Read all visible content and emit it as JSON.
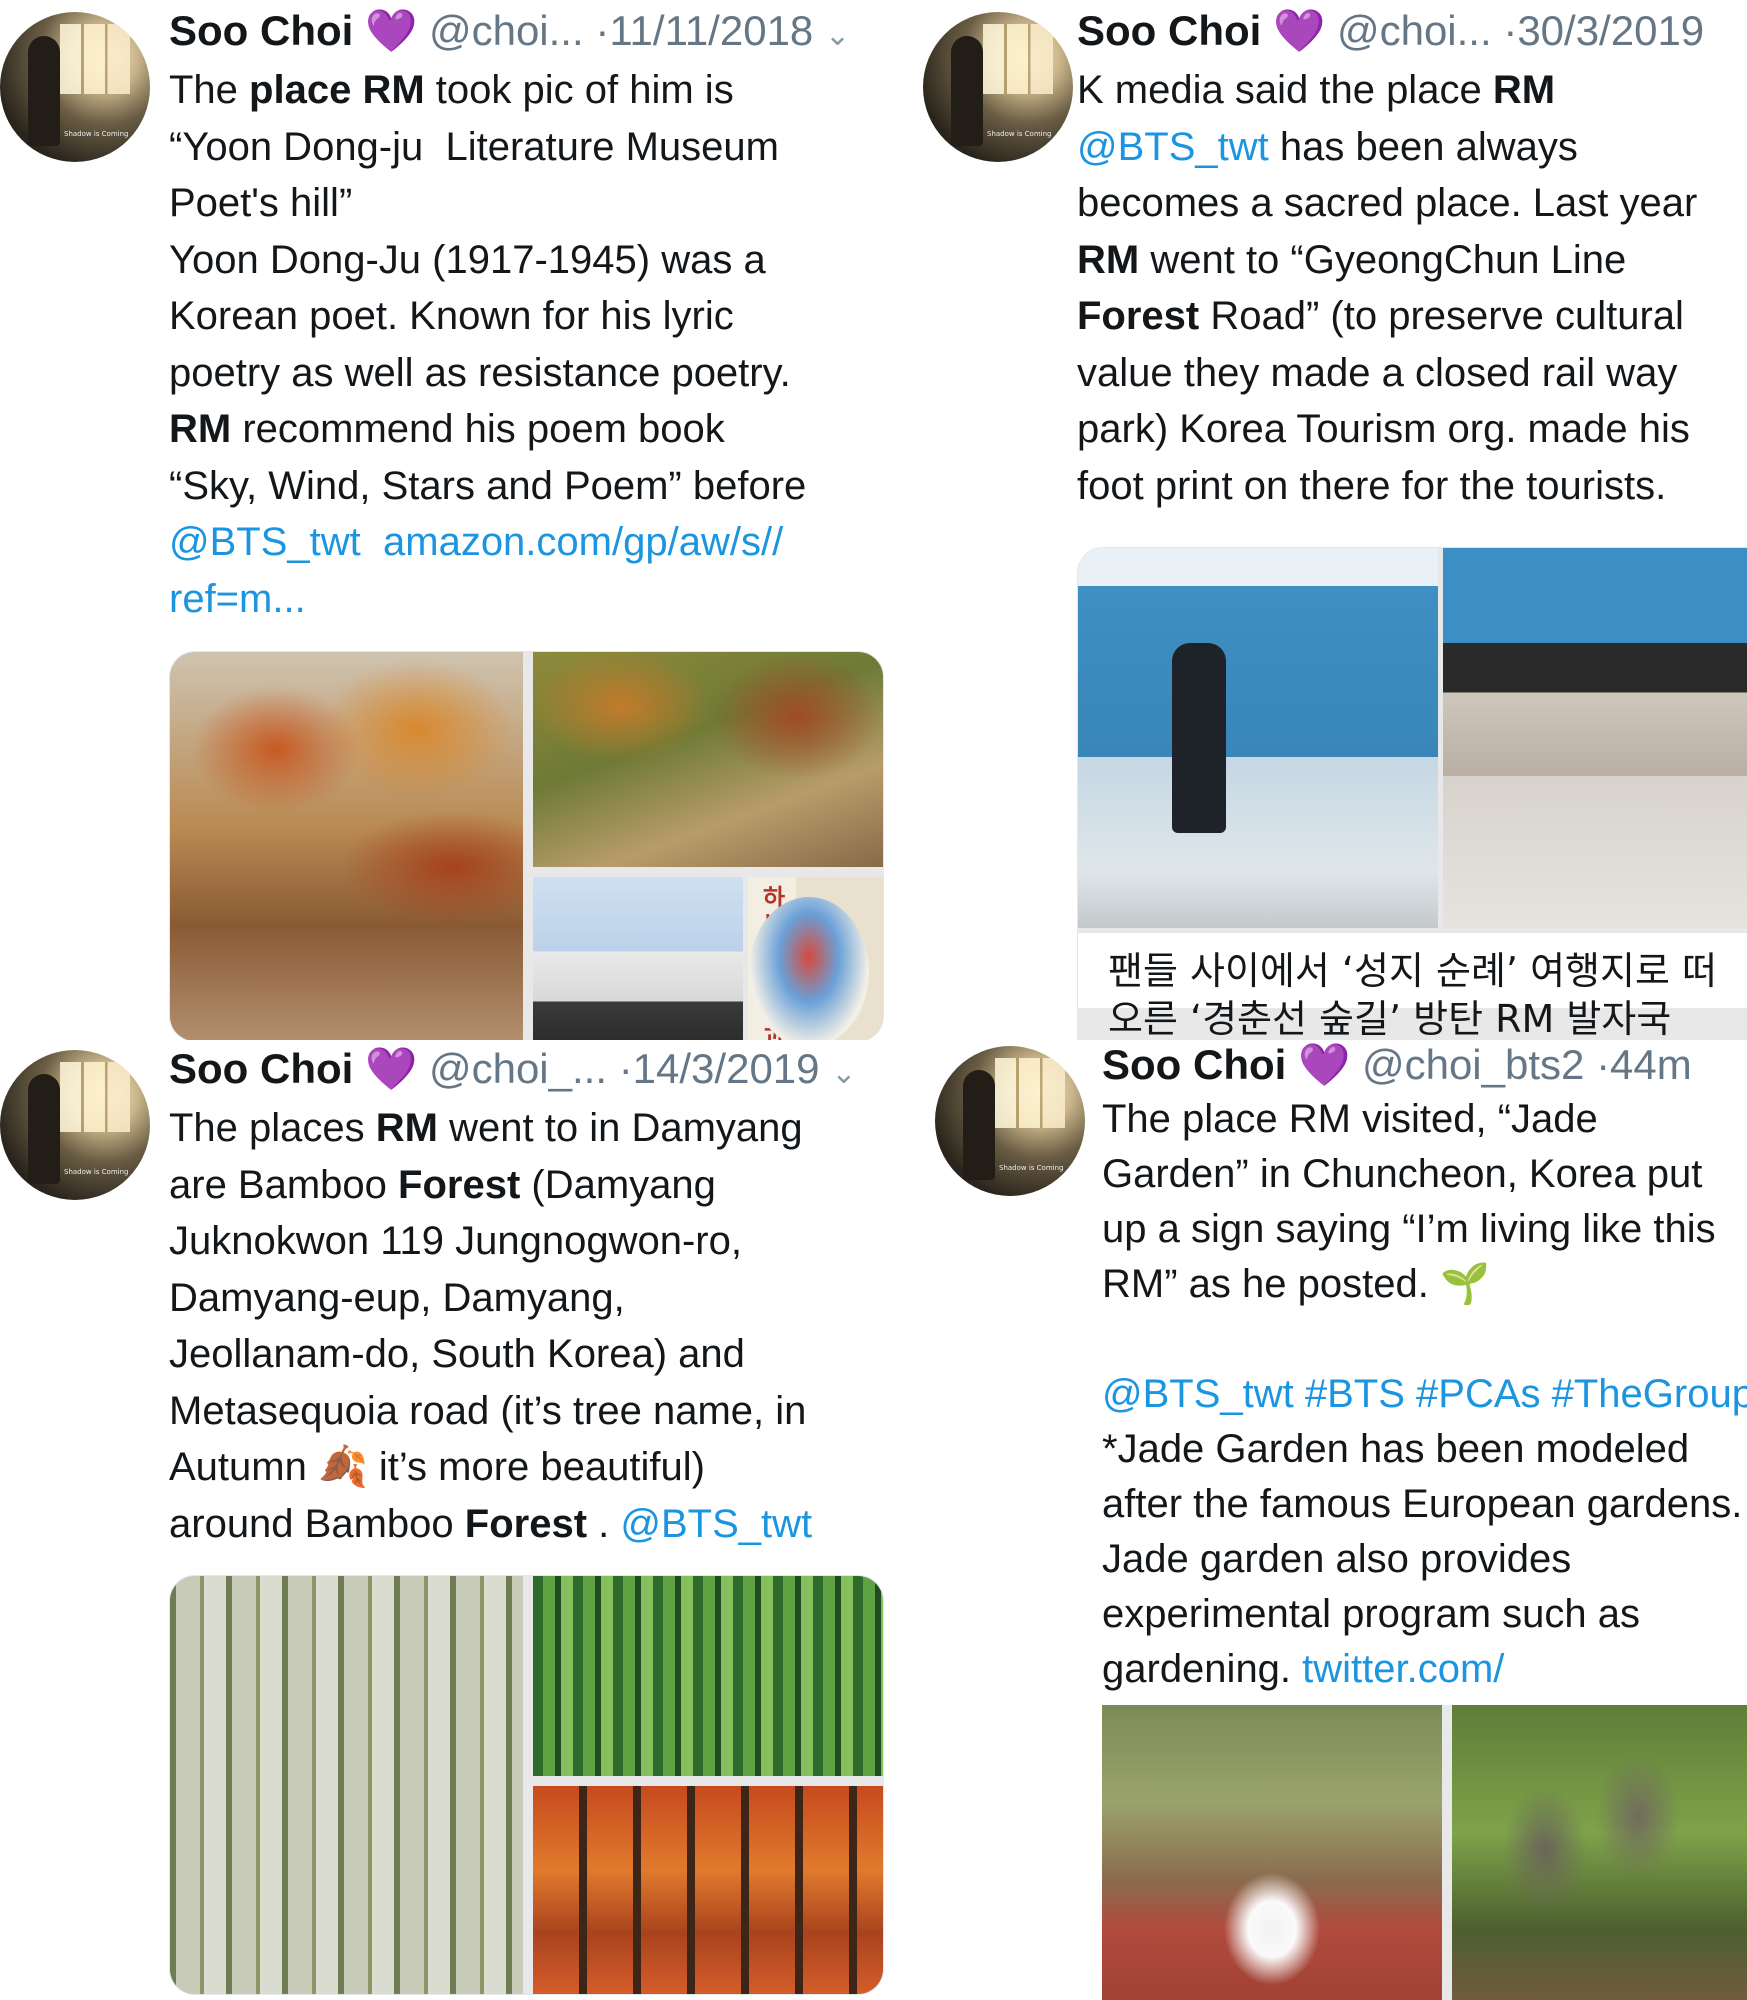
{
  "tweets": [
    {
      "name": "Soo Choi",
      "heart": "💜",
      "handle": "@choi...",
      "date": "·11/11/2018",
      "caret": "⌄",
      "body_lines": [
        [
          {
            "t": "The "
          },
          {
            "t": "place",
            "b": true
          },
          {
            "t": " "
          },
          {
            "t": "RM",
            "b": true
          },
          {
            "t": " took pic of him is"
          }
        ],
        [
          {
            "t": "“Yoon Dong-ju  Literature Museum"
          }
        ],
        [
          {
            "t": "Poet's hill”"
          }
        ],
        [
          {
            "t": "Yoon Dong-Ju (1917-1945) was a"
          }
        ],
        [
          {
            "t": "Korean poet. Known for his lyric"
          }
        ],
        [
          {
            "t": "poetry as well as resistance poetry."
          }
        ],
        [
          {
            "t": "RM",
            "b": true
          },
          {
            "t": " recommend his poem book"
          }
        ],
        [
          {
            "t": "“Sky, Wind, Stars and Poem” before"
          }
        ],
        [
          {
            "t": "@BTS_twt",
            "link": true
          },
          {
            "t": "  "
          },
          {
            "t": "amazon.com/gp/aw/s//",
            "link": true
          }
        ],
        [
          {
            "t": "ref=m...",
            "link": true
          }
        ]
      ],
      "book_title": "하늘과바람과별과詩"
    },
    {
      "name": "Soo Choi",
      "heart": "💜",
      "handle": "@choi...",
      "date": "·30/3/2019",
      "body_lines": [
        [
          {
            "t": "K media said the place "
          },
          {
            "t": "RM",
            "b": true
          }
        ],
        [
          {
            "t": "@BTS_twt",
            "link": true
          },
          {
            "t": " has been always"
          }
        ],
        [
          {
            "t": "becomes a sacred place. Last year"
          }
        ],
        [
          {
            "t": "RM",
            "b": true
          },
          {
            "t": " went to “GyeongChun Line"
          }
        ],
        [
          {
            "t": "Forest",
            "b": true
          },
          {
            "t": " Road” (to preserve cultural"
          }
        ],
        [
          {
            "t": "value they made a closed rail way"
          }
        ],
        [
          {
            "t": "park) Korea Tourism org. made his"
          }
        ],
        [
          {
            "t": "foot print on there for the tourists."
          }
        ]
      ],
      "caption_lines": [
        "팬들 사이에서 ‘성지 순례’ 여행지로 떠",
        "오른 ‘경춘선 숲길’ 방탄 RM 발자국"
      ]
    },
    {
      "name": "Soo Choi",
      "heart": "💜",
      "handle": "@choi_...",
      "date": "·14/3/2019",
      "caret": "⌄",
      "body_lines": [
        [
          {
            "t": "The places "
          },
          {
            "t": "RM",
            "b": true
          },
          {
            "t": " went to in Damyang"
          }
        ],
        [
          {
            "t": "are Bamboo "
          },
          {
            "t": "Forest",
            "b": true
          },
          {
            "t": " (Damyang"
          }
        ],
        [
          {
            "t": "Juknokwon 119 Jungnogwon-ro,"
          }
        ],
        [
          {
            "t": "Damyang-eup, Damyang,"
          }
        ],
        [
          {
            "t": "Jeollanam-do, South Korea) and"
          }
        ],
        [
          {
            "t": "Metasequoia road (it’s tree name, in"
          }
        ],
        [
          {
            "t": "Autumn "
          },
          {
            "t": "🍂",
            "leaf": true
          },
          {
            "t": " it’s more beautiful)"
          }
        ],
        [
          {
            "t": "around Bamboo "
          },
          {
            "t": "Forest",
            "b": true
          },
          {
            "t": " . "
          },
          {
            "t": "@BTS_twt",
            "link": true
          }
        ]
      ]
    },
    {
      "name": "Soo Choi",
      "heart": "💜",
      "handle": "@choi_bts2",
      "date": "·44m",
      "body_lines": [
        [
          {
            "t": "The place RM visited, “Jade"
          }
        ],
        [
          {
            "t": "Garden” in Chuncheon, Korea put"
          }
        ],
        [
          {
            "t": "up a sign saying “I’m living like this"
          }
        ],
        [
          {
            "t": "RM” as he posted. "
          },
          {
            "t": "🌱",
            "sprout": true
          }
        ],
        [
          {
            "t": ""
          }
        ],
        [
          {
            "t": "@BTS_twt #BTS #PCAs #TheGroup",
            "link": true
          }
        ],
        [
          {
            "t": "*Jade Garden has been modeled"
          }
        ],
        [
          {
            "t": "after the famous European gardens."
          }
        ],
        [
          {
            "t": "Jade garden also provides"
          }
        ],
        [
          {
            "t": "experimental program such as"
          }
        ],
        [
          {
            "t": "gardening. "
          },
          {
            "t": "twitter.com/",
            "link": true
          }
        ]
      ]
    }
  ],
  "avatar_caption": "Shadow is Coming"
}
